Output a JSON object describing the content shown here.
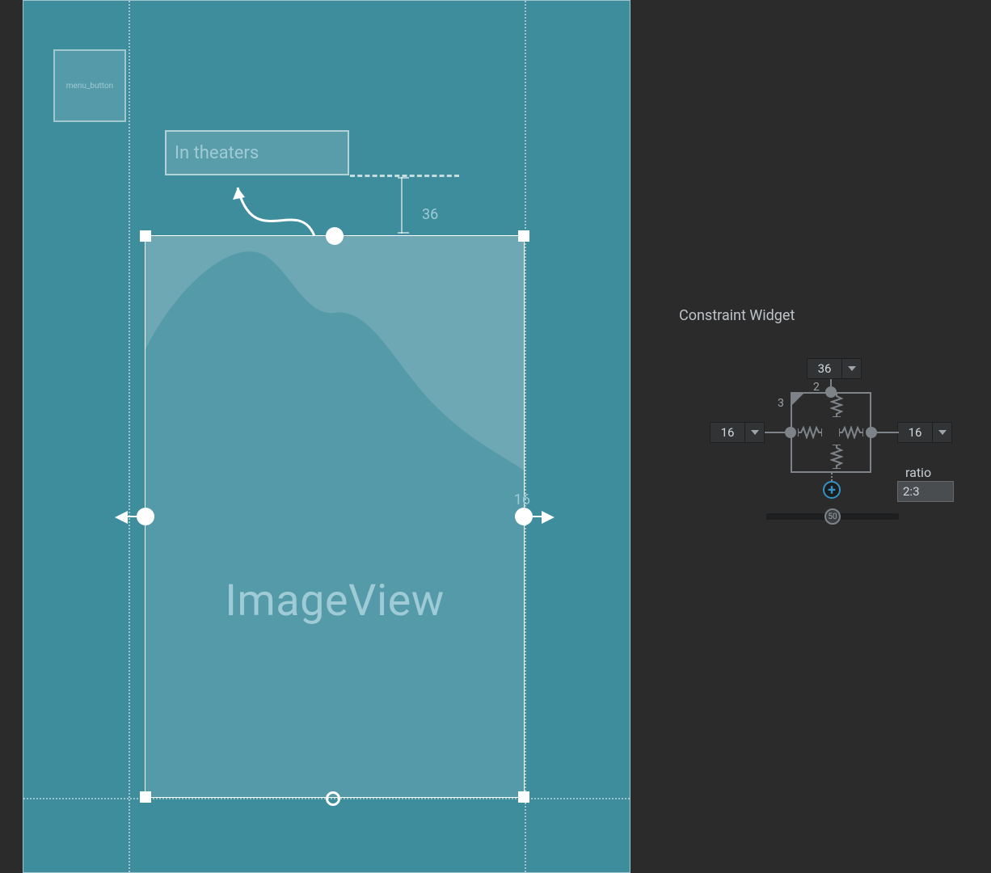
{
  "canvas": {
    "menu_button_label": "menu_button",
    "title_label": "In theaters",
    "vertical_margin": "36",
    "horizontal_margin": "16",
    "imageview_label": "ImageView"
  },
  "inspector": {
    "title": "Constraint Widget",
    "margins": {
      "top": "36",
      "left": "16",
      "right": "16"
    },
    "ratio_label": "ratio",
    "ratio_value": "2:3",
    "ratio_w": "2",
    "ratio_h": "3",
    "bias": "50"
  }
}
